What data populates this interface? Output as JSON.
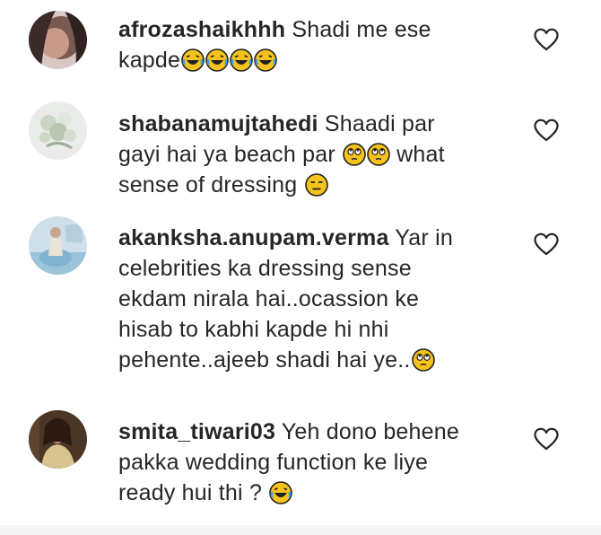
{
  "comments": [
    {
      "username": "afrozashaikhhh",
      "text": "Shadi me ese\nkapde",
      "emojis_after": [
        "laughing-tears",
        "laughing-tears",
        "laughing-tears",
        "laughing-tears"
      ],
      "avatar_icon": "avatar-photo"
    },
    {
      "username": "shabanamujtahedi",
      "text_part1": "Shaadi par\ngayi hai ya beach par ",
      "mid_emojis": [
        "eye-roll",
        "eye-roll"
      ],
      "text_part2": " what\nsense of dressing ",
      "emojis_after": [
        "expressionless"
      ],
      "avatar_icon": "avatar-photo"
    },
    {
      "username": "akanksha.anupam.verma",
      "text": "Yar in\ncelebrities ka dressing sense\nekdam nirala hai..ocassion ke\nhisab to kabhi kapde hi nhi\npehente..ajeeb shadi hai ye..",
      "emojis_after": [
        "eye-roll"
      ],
      "avatar_icon": "avatar-photo"
    },
    {
      "username": "smita_tiwari03",
      "text": "Yeh dono behene\npakka wedding function ke liye\nready hui thi ? ",
      "emojis_after": [
        "laughing-tears"
      ],
      "avatar_icon": "avatar-photo"
    }
  ],
  "icons": {
    "like": "heart-outline-icon"
  },
  "colors": {
    "text": "#262626",
    "emoji": "#f5c518",
    "heart": "#262626"
  }
}
